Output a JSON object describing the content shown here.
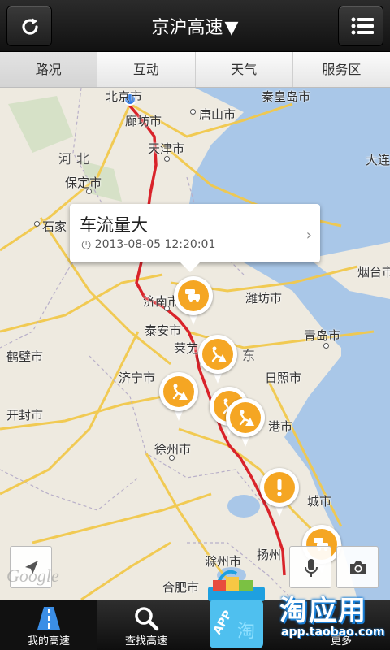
{
  "header": {
    "title": "京沪高速",
    "refresh_icon": "refresh-icon",
    "menu_icon": "list-menu-icon"
  },
  "tabs": [
    {
      "label": "路况",
      "active": true
    },
    {
      "label": "互动",
      "active": false
    },
    {
      "label": "天气",
      "active": false
    },
    {
      "label": "服务区",
      "active": false
    }
  ],
  "map": {
    "cities": [
      "北京市",
      "廊坊市",
      "唐山市",
      "秦皇岛市",
      "天津市",
      "大连",
      "保定市",
      "石家",
      "济南市",
      "泰安市",
      "莱芜",
      "潍坊市",
      "青岛市",
      "烟台市",
      "鹤壁市",
      "济宁市",
      "日照市",
      "开封市",
      "港市",
      "徐州市",
      "城市",
      "扬州",
      "滁州市",
      "合肥市"
    ],
    "regions": [
      "河北",
      "东"
    ],
    "popup": {
      "title": "车流量大",
      "time": "2013-08-05 12:20:01"
    },
    "pins": [
      {
        "type": "traffic-jam",
        "color": "#f5a623"
      },
      {
        "type": "road-work",
        "color": "#f5a623"
      },
      {
        "type": "road-work",
        "color": "#f5a623"
      },
      {
        "type": "road-work",
        "color": "#f5a623"
      },
      {
        "type": "road-work",
        "color": "#f5a623"
      },
      {
        "type": "warning",
        "color": "#f5a623"
      },
      {
        "type": "traffic-jam",
        "color": "#f5a623"
      }
    ],
    "route_color": "#d9232a",
    "attribution": "Google"
  },
  "bottom_nav": [
    {
      "label": "我的高速",
      "icon": "highway-icon",
      "active": true
    },
    {
      "label": "查找高速",
      "icon": "search-icon",
      "active": false
    },
    {
      "label": "",
      "icon": "",
      "active": false
    },
    {
      "label": "更多",
      "icon": "more-icon",
      "active": false
    }
  ],
  "watermark": {
    "brand": "淘应用",
    "url": "app.taobao.com",
    "bag_label": "APP",
    "bag_char": "淘"
  }
}
